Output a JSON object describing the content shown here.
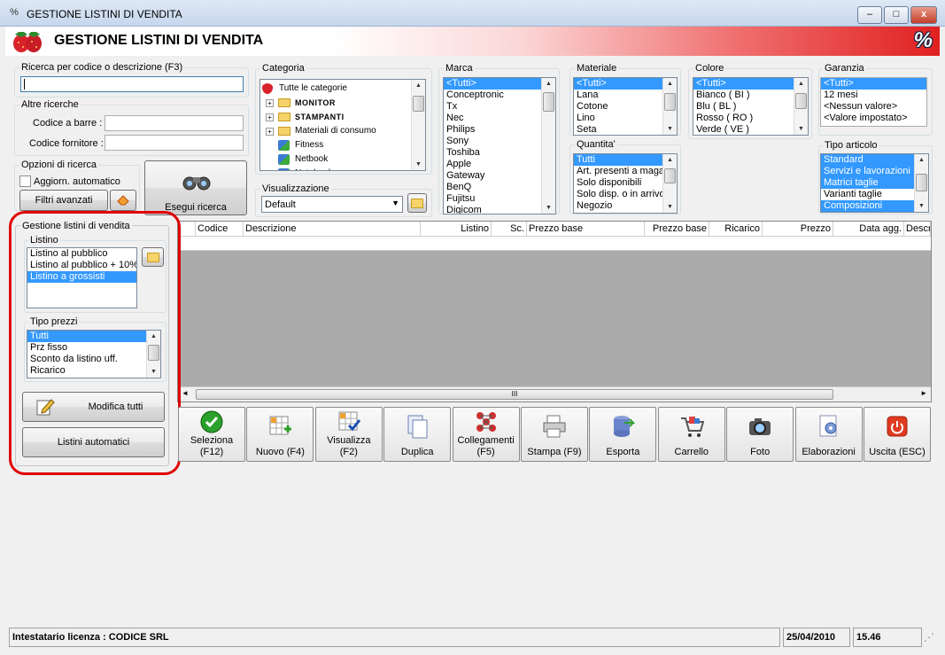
{
  "window": {
    "title": "GESTIONE LISTINI DI VENDITA",
    "min": "–",
    "max": "□",
    "close": "x"
  },
  "header": {
    "title": "GESTIONE LISTINI DI VENDITA",
    "logo": "%"
  },
  "search": {
    "label": "Ricerca per codice o descrizione (F3)",
    "value": ""
  },
  "other": {
    "title": "Altre ricerche",
    "barcode_label": "Codice a barre :",
    "supplier_label": "Codice fornitore :"
  },
  "options": {
    "title": "Opzioni di ricerca",
    "auto_update": "Aggiorn. automatico",
    "advanced": "Filtri avanzati",
    "execute": "Esegui ricerca"
  },
  "categoria": {
    "title": "Categoria",
    "items": [
      "Tutte le categorie",
      "MONITOR",
      "STAMPANTI",
      "Materiali di consumo",
      "Fitness",
      "Netbook",
      "Notebook"
    ]
  },
  "visualizzazione": {
    "title": "Visualizzazione",
    "value": "Default"
  },
  "marca": {
    "title": "Marca",
    "items": [
      "<Tutti>",
      "Conceptronic",
      "Tx",
      "Nec",
      "Philips",
      "Sony",
      "Toshiba",
      "Apple",
      "Gateway",
      "BenQ",
      "Fujitsu",
      "Digicom"
    ]
  },
  "materiale": {
    "title": "Materiale",
    "items": [
      "<Tutti>",
      "Lana",
      "Cotone",
      "Lino",
      "Seta"
    ]
  },
  "quantita": {
    "title": "Quantita'",
    "items": [
      "Tutti",
      "Art. presenti a magazzino",
      "Solo disponibili",
      "Solo disp. o in arrivo",
      "Negozio"
    ]
  },
  "colore": {
    "title": "Colore",
    "items": [
      "<Tutti>",
      "Bianco ( BI )",
      "Blu ( BL )",
      "Rosso ( RO )",
      "Verde ( VE )"
    ]
  },
  "garanzia": {
    "title": "Garanzia",
    "items": [
      "<Tutti>",
      "12 mesi",
      "<Nessun valore>",
      "<Valore impostato>"
    ]
  },
  "tipo_articolo": {
    "title": "Tipo articolo",
    "items": [
      "Standard",
      "Servizi e lavorazioni",
      "Matrici taglie",
      "Varianti taglie",
      "Composizioni"
    ]
  },
  "gestione": {
    "title": "Gestione listini di vendita",
    "listino_title": "Listino",
    "listino_items": [
      "Listino al pubblico",
      "Listino al pubblico + 10%",
      "Listino a grossisti"
    ],
    "tipo_title": "Tipo prezzi",
    "tipo_items": [
      "Tutti",
      "Prz fisso",
      "Sconto da listino uff.",
      "Ricarico"
    ],
    "modifica": "Modifica tutti",
    "automatici": "Listini automatici"
  },
  "table": {
    "columns": [
      "Codice",
      "Descrizione",
      "Listino",
      "Sc.",
      "Prezzo base",
      "Prezzo base",
      "Ricarico",
      "Prezzo",
      "Data agg.",
      "Descr"
    ]
  },
  "toolbar": [
    "Seleziona (F12)",
    "Nuovo (F4)",
    "Visualizza (F2)",
    "Duplica",
    "Collegamenti (F5)",
    "Stampa (F9)",
    "Esporta",
    "Carrello",
    "Foto",
    "Elaborazioni",
    "Uscita (ESC)"
  ],
  "status": {
    "license": "Intestatario licenza : CODICE SRL",
    "date": "25/04/2010",
    "time": "15.46"
  },
  "colors": {
    "selection": "#3399ff",
    "highlight_ring": "#e00000",
    "grid_bg": "#aaaaaa"
  }
}
